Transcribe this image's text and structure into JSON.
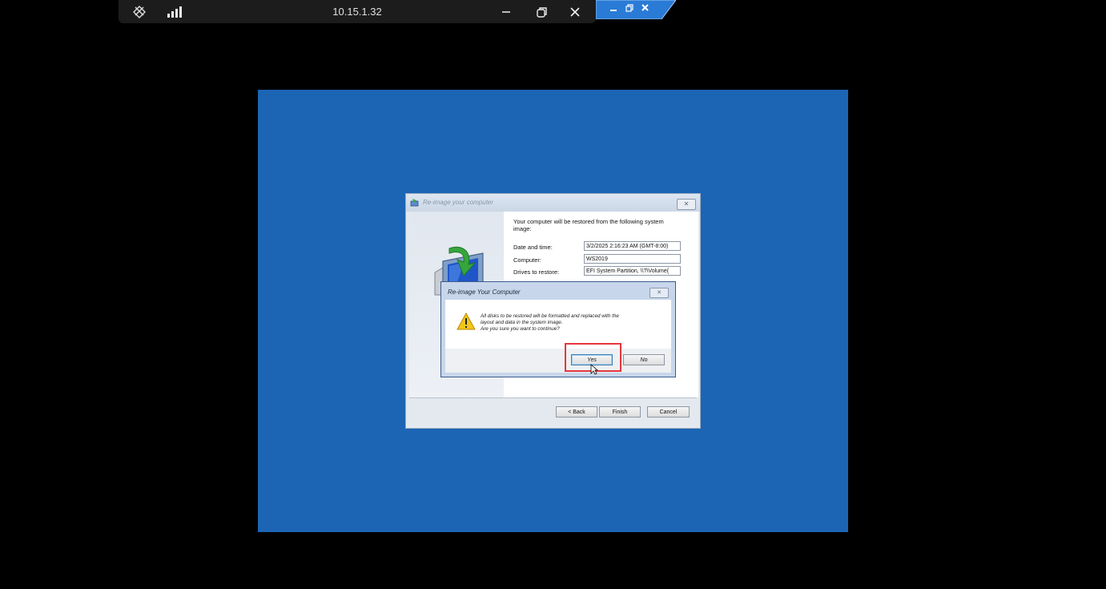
{
  "connection_bar": {
    "host": "10.15.1.32",
    "icons": [
      "pin-icon",
      "signal-strength-icon",
      "minimize-icon",
      "restore-icon",
      "close-icon"
    ]
  },
  "vm_window_controls": [
    "minimize-icon",
    "restore-icon",
    "close-icon"
  ],
  "wizard": {
    "title": "Re-image your computer",
    "intro": "Your computer will be restored from the following system image:",
    "rows": [
      {
        "label": "Date and time:",
        "value": "3/2/2025 2:16:23 AM (GMT-8:00)"
      },
      {
        "label": "Computer:",
        "value": "WS2019"
      },
      {
        "label": "Drives to restore:",
        "value": "EFI System Partition, \\\\?\\Volume{"
      }
    ],
    "buttons": {
      "back": "< Back",
      "finish": "Finish",
      "cancel": "Cancel"
    }
  },
  "confirm_dialog": {
    "title": "Re-image Your Computer",
    "message_lines": [
      "All disks to be restored will be formatted and replaced with the",
      "layout and data in the system image.",
      "Are you sure you want to continue?"
    ],
    "yes_label": "Yes",
    "no_label": "No"
  },
  "colors": {
    "vm_background": "#1c65b5",
    "highlight": "#e5373c",
    "warning": "#f5c518"
  }
}
